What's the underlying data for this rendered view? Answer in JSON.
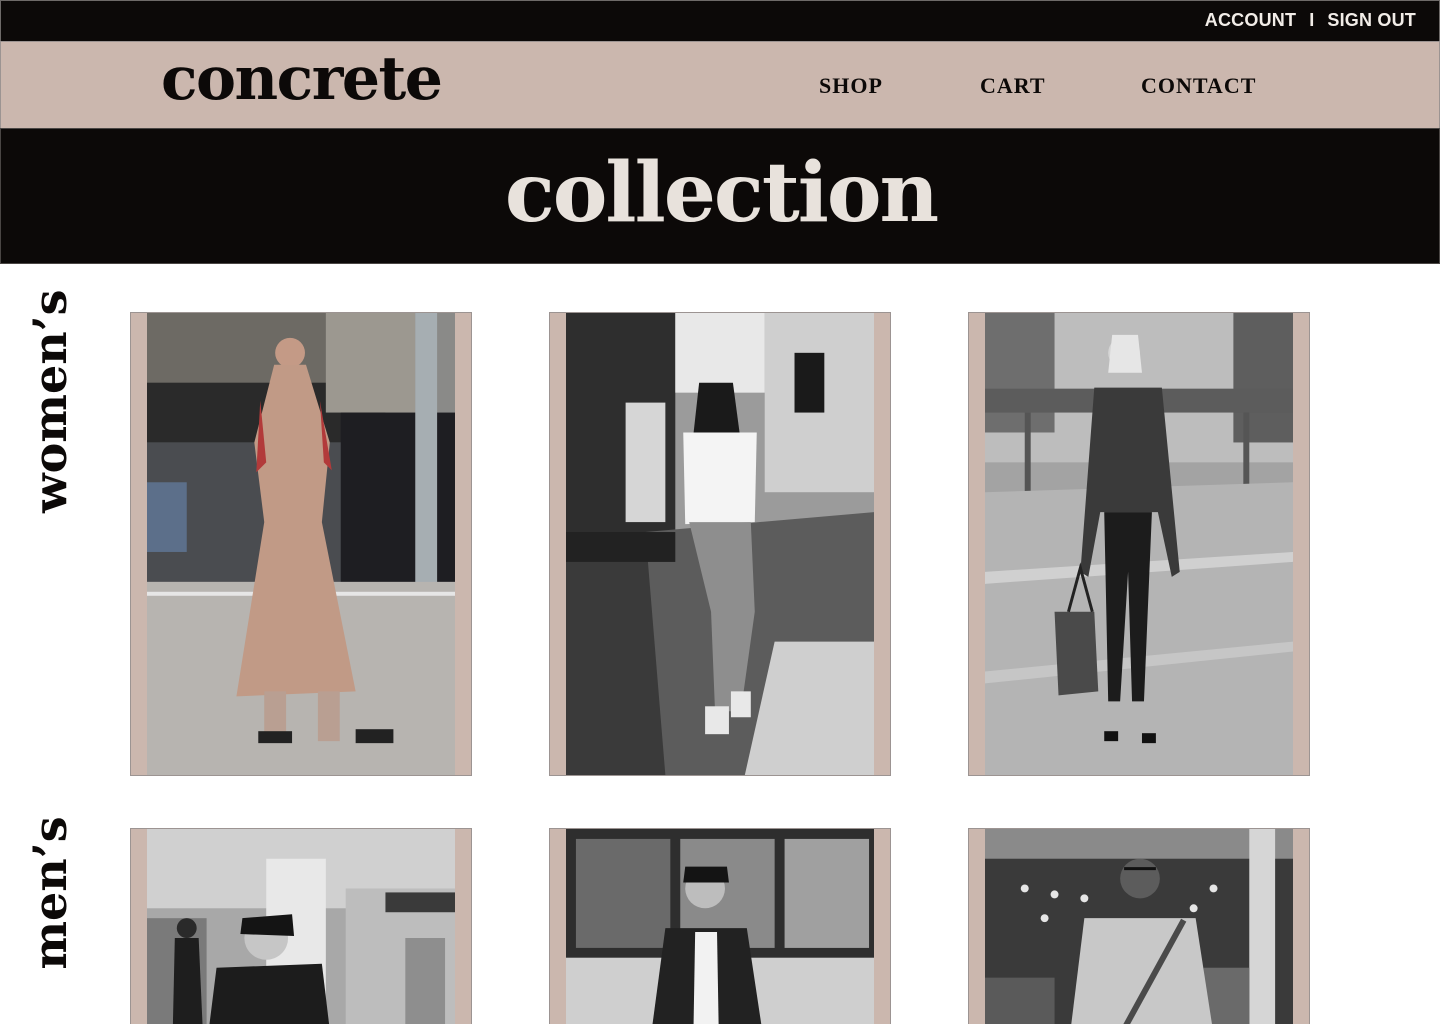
{
  "account_bar": {
    "account_label": "ACCOUNT",
    "separator": "I",
    "signout_label": "SIGN OUT"
  },
  "header": {
    "logo": "concrete",
    "nav": [
      "SHOP",
      "CART",
      "CONTACT"
    ]
  },
  "hero": {
    "title": "collection"
  },
  "sections": {
    "womens_label": "women’s",
    "mens_label": "men’s"
  },
  "colors": {
    "accent_tan": "#cbb7ae",
    "dark": "#0c0908",
    "hero_text": "#e8e2dc"
  }
}
